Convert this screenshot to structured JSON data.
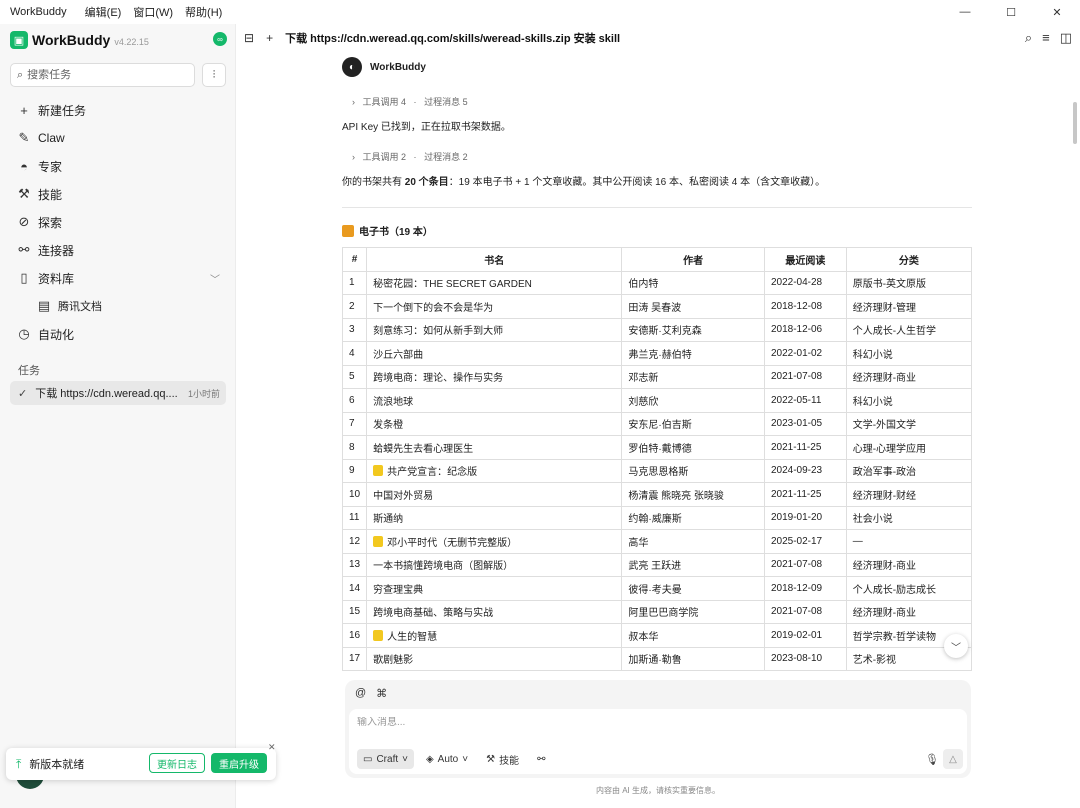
{
  "menubar": {
    "app": "WorkBuddy",
    "items": [
      "编辑(E)",
      "窗口(W)",
      "帮助(H)"
    ]
  },
  "window_controls": {
    "min": "—",
    "max": "☐",
    "close": "✕"
  },
  "brand": {
    "name": "WorkBuddy",
    "version": "v4.22.15"
  },
  "sidebar": {
    "search_placeholder": "搜索任务",
    "items": [
      "新建任务",
      "Claw",
      "专家",
      "技能",
      "探索",
      "连接器",
      "资料库",
      "腾讯文档",
      "自动化"
    ],
    "section": "任务",
    "task": {
      "title": "下载 https://cdn.weread.qq....",
      "time": "1小时前"
    }
  },
  "toast": {
    "text": "新版本就绪",
    "btn_log": "更新日志",
    "btn_restart": "重启升级"
  },
  "header": {
    "title": "下载 https://cdn.weread.qq.com/skills/weread-skills.zip 安装 skill"
  },
  "chat": {
    "bot_name": "WorkBuddy",
    "tool1": {
      "a": "工具调用 4",
      "sep": "·",
      "b": "过程消息 5"
    },
    "msg1": "API Key 已找到，正在拉取书架数据。",
    "tool2": {
      "a": "工具调用 2",
      "sep": "·",
      "b": "过程消息 2"
    },
    "msg2_pre": "你的书架共有 ",
    "msg2_bold": "20 个条目",
    "msg2_post": "：19 本电子书 + 1 个文章收藏。其中公开阅读 16 本、私密阅读 4 本（含文章收藏）。",
    "section_title": "电子书（19 本）"
  },
  "table": {
    "headers": [
      "#",
      "书名",
      "作者",
      "最近阅读",
      "分类"
    ],
    "rows": [
      [
        "1",
        "秘密花园：THE SECRET GARDEN",
        "伯内特",
        "2022-04-28",
        "原版书-英文原版"
      ],
      [
        "2",
        "下一个倒下的会不会是华为",
        "田涛 吴春波",
        "2018-12-08",
        "经济理财-管理"
      ],
      [
        "3",
        "刻意练习：如何从新手到大师",
        "安德斯·艾利克森",
        "2018-12-06",
        "个人成长-人生哲学"
      ],
      [
        "4",
        "沙丘六部曲",
        "弗兰克·赫伯特",
        "2022-01-02",
        "科幻小说"
      ],
      [
        "5",
        "跨境电商：理论、操作与实务",
        "邓志新",
        "2021-07-08",
        "经济理财-商业"
      ],
      [
        "6",
        "流浪地球",
        "刘慈欣",
        "2022-05-11",
        "科幻小说"
      ],
      [
        "7",
        "发条橙",
        "安东尼·伯吉斯",
        "2023-01-05",
        "文学-外国文学"
      ],
      [
        "8",
        "蛤蟆先生去看心理医生",
        "罗伯特·戴博德",
        "2021-11-25",
        "心理-心理学应用"
      ],
      [
        "9",
        "共产党宣言：纪念版",
        "马克思恩格斯",
        "2024-09-23",
        "政治军事-政治"
      ],
      [
        "10",
        "中国对外贸易",
        "杨清震 熊晓亮 张晓骏",
        "2021-11-25",
        "经济理财-财经"
      ],
      [
        "11",
        "斯通纳",
        "约翰·威廉斯",
        "2019-01-20",
        "社会小说"
      ],
      [
        "12",
        "邓小平时代（无删节完整版）",
        "高华",
        "2025-02-17",
        "—"
      ],
      [
        "13",
        "一本书搞懂跨境电商（图解版）",
        "武亮 王跃进",
        "2021-07-08",
        "经济理财-商业"
      ],
      [
        "14",
        "穷查理宝典",
        "彼得·考夫曼",
        "2018-12-09",
        "个人成长-励志成长"
      ],
      [
        "15",
        "跨境电商基础、策略与实战",
        "阿里巴巴商学院",
        "2021-07-08",
        "经济理财-商业"
      ],
      [
        "16",
        "人生的智慧",
        "叔本华",
        "2019-02-01",
        "哲学宗教-哲学读物"
      ],
      [
        "17",
        "歌剧魅影",
        "加斯通·勒鲁",
        "2023-08-10",
        "艺术-影视"
      ]
    ],
    "locked_rows": [
      8,
      11,
      15
    ]
  },
  "input": {
    "placeholder": "输入消息...",
    "mode": "Craft",
    "model": "Auto",
    "skills": "技能"
  },
  "footer": "内容由 AI 生成，请核实重要信息。"
}
